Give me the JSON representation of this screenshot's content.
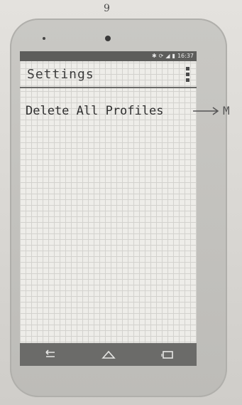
{
  "page": {
    "number": "9"
  },
  "status_bar": {
    "time": "16:37"
  },
  "app_bar": {
    "title": "Settings"
  },
  "settings_list": [
    {
      "label": "Delete All Profiles"
    }
  ],
  "annotation": {
    "text": "M"
  },
  "nav_bar": {
    "icons": [
      "back-icon",
      "home-icon",
      "recent-apps-icon"
    ]
  },
  "colors": {
    "status_bar": "#5d5d5b",
    "nav_bar": "#6b6b69",
    "screen": "#eeede9",
    "phone_body": "#c4c3bf"
  }
}
